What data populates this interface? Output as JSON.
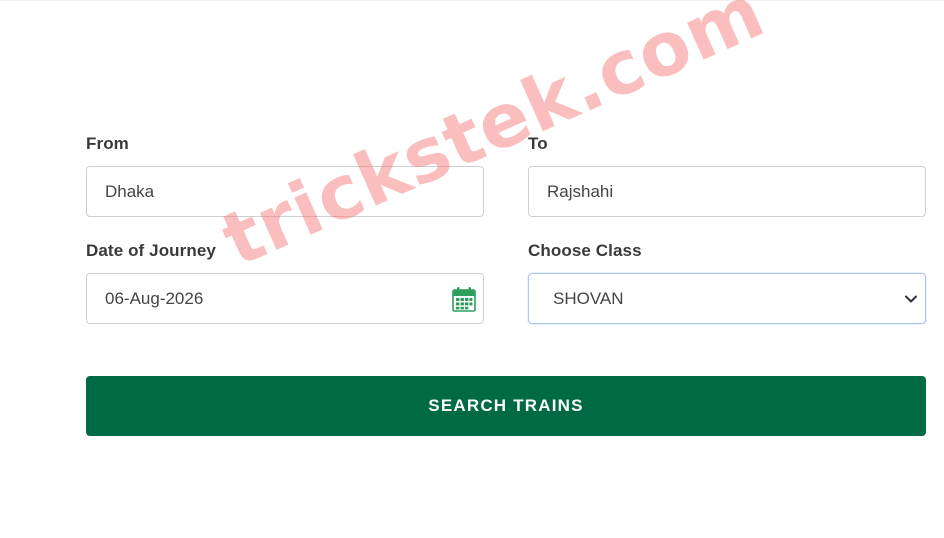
{
  "form": {
    "from": {
      "label": "From",
      "value": "Dhaka"
    },
    "to": {
      "label": "To",
      "value": "Rajshahi"
    },
    "date": {
      "label": "Date of Journey",
      "value": "06-Aug-2026",
      "icon": "calendar-icon"
    },
    "class": {
      "label": "Choose Class",
      "selected": "SHOVAN",
      "icon": "chevron-down-icon"
    }
  },
  "search_button": {
    "label": "SEARCH TRAINS"
  },
  "watermark": {
    "text": "trickstek.com"
  },
  "colors": {
    "primary_button": "#006a44",
    "calendar_icon": "#2e9e5e",
    "watermark": "#f56e6e"
  }
}
